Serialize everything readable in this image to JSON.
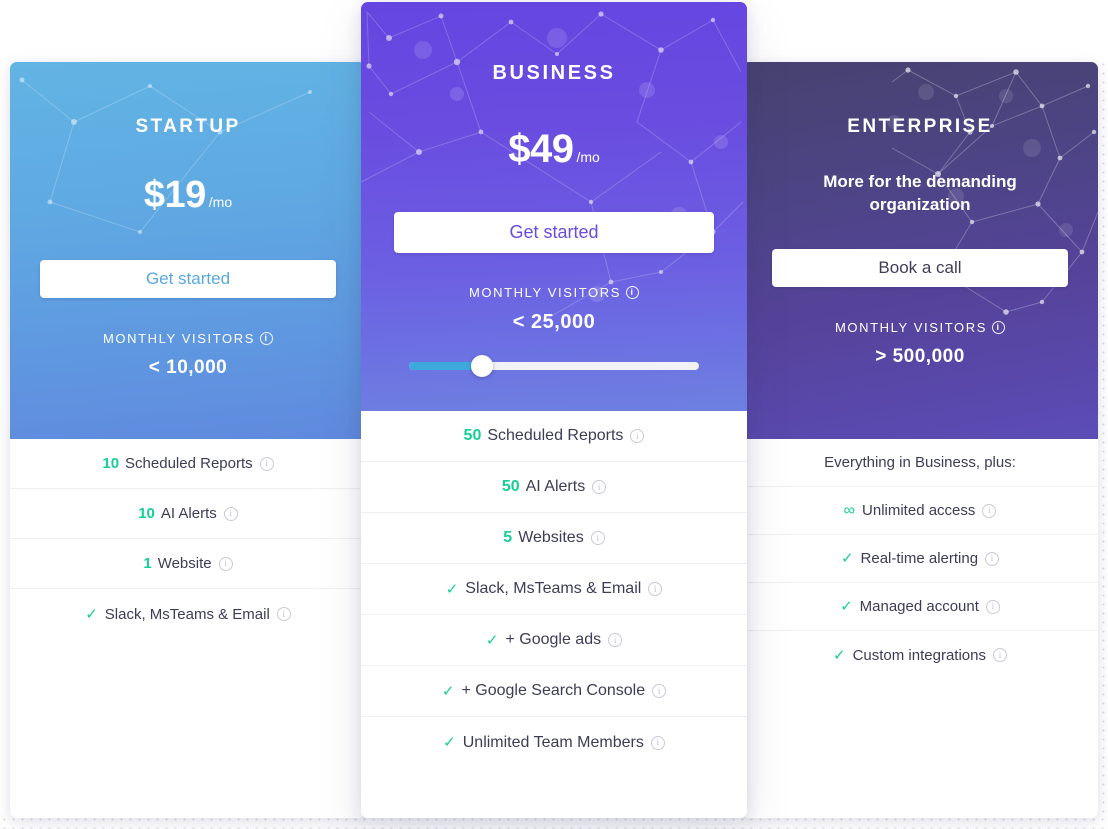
{
  "accent": {
    "green": "#16cf98",
    "startup_blue": "#59a8e2",
    "business_purple": "#6a4ae0",
    "enterprise_dark": "#3f3c58",
    "slider_fill": "#3fa9dd"
  },
  "plans": [
    {
      "id": "startup",
      "name": "STARTUP",
      "price_amount": "$19",
      "price_unit": "/mo",
      "cta_label": "Get started",
      "visitors_label": "MONTHLY VISITORS",
      "visitors_value": "< 10,000",
      "info_glyph": "i",
      "features": [
        {
          "qty": "10",
          "text": "Scheduled Reports",
          "info": "i"
        },
        {
          "qty": "10",
          "text": "AI Alerts",
          "info": "i"
        },
        {
          "qty": "1",
          "text": "Website",
          "info": "i"
        },
        {
          "check": "✓",
          "text": "Slack, MsTeams & Email",
          "info": "i"
        }
      ]
    },
    {
      "id": "business",
      "name": "BUSINESS",
      "price_amount": "$49",
      "price_unit": "/mo",
      "cta_label": "Get started",
      "visitors_label": "MONTHLY VISITORS",
      "visitors_value": "< 25,000",
      "info_glyph": "i",
      "slider": {
        "percent": 25,
        "min_label": "",
        "max_label": ""
      },
      "features": [
        {
          "qty": "50",
          "text": "Scheduled Reports",
          "info": "i"
        },
        {
          "qty": "50",
          "text": "AI Alerts",
          "info": "i"
        },
        {
          "qty": "5",
          "text": "Websites",
          "info": "i"
        },
        {
          "check": "✓",
          "text": "Slack, MsTeams & Email",
          "info": "i"
        },
        {
          "check": "✓",
          "text": "+ Google ads",
          "info": "i"
        },
        {
          "check": "✓",
          "text": "+ Google Search Console",
          "info": "i"
        },
        {
          "check": "✓",
          "text": "Unlimited Team Members",
          "info": "i"
        }
      ]
    },
    {
      "id": "enterprise",
      "name": "ENTERPRISE",
      "tagline": "More for the demanding organization",
      "cta_label": "Book a call",
      "visitors_label": "MONTHLY VISITORS",
      "visitors_value": "> 500,000",
      "info_glyph": "i",
      "features": [
        {
          "text": "Everything in Business, plus:"
        },
        {
          "symbol": "∞",
          "text": "Unlimited access",
          "info": "i"
        },
        {
          "check": "✓",
          "text": "Real-time alerting",
          "info": "i"
        },
        {
          "check": "✓",
          "text": "Managed account",
          "info": "i"
        },
        {
          "check": "✓",
          "text": "Custom integrations",
          "info": "i"
        }
      ]
    }
  ]
}
